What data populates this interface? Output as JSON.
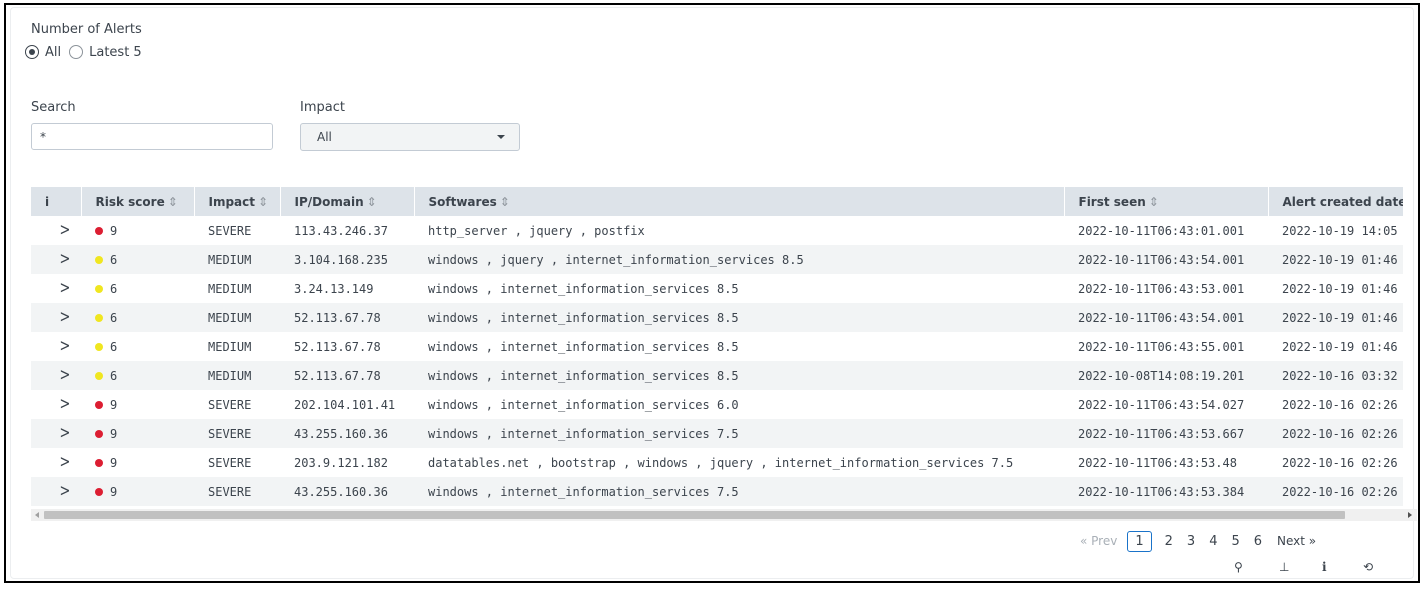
{
  "alerts_filter": {
    "label": "Number of Alerts",
    "options": [
      "All",
      "Latest 5"
    ],
    "selected": "All"
  },
  "search": {
    "label": "Search",
    "value": "*"
  },
  "impact_filter": {
    "label": "Impact",
    "selected": "All"
  },
  "table": {
    "columns": [
      "i",
      "Risk score",
      "Impact",
      "IP/Domain",
      "Softwares",
      "First seen",
      "Alert created date"
    ],
    "severity_colors": {
      "SEVERE": "#dc1e32",
      "MEDIUM": "#f0e620"
    },
    "rows": [
      {
        "risk": "9",
        "impact": "SEVERE",
        "ip": "113.43.246.37",
        "softwares": "http_server , jquery , postfix",
        "first_seen": "2022-10-11T06:43:01.001",
        "created": "2022-10-19 14:05"
      },
      {
        "risk": "6",
        "impact": "MEDIUM",
        "ip": "3.104.168.235",
        "softwares": "windows , jquery , internet_information_services 8.5",
        "first_seen": "2022-10-11T06:43:54.001",
        "created": "2022-10-19 01:46"
      },
      {
        "risk": "6",
        "impact": "MEDIUM",
        "ip": "3.24.13.149",
        "softwares": "windows , internet_information_services 8.5",
        "first_seen": "2022-10-11T06:43:53.001",
        "created": "2022-10-19 01:46"
      },
      {
        "risk": "6",
        "impact": "MEDIUM",
        "ip": "52.113.67.78",
        "softwares": "windows , internet_information_services 8.5",
        "first_seen": "2022-10-11T06:43:54.001",
        "created": "2022-10-19 01:46"
      },
      {
        "risk": "6",
        "impact": "MEDIUM",
        "ip": "52.113.67.78",
        "softwares": "windows , internet_information_services 8.5",
        "first_seen": "2022-10-11T06:43:55.001",
        "created": "2022-10-19 01:46"
      },
      {
        "risk": "6",
        "impact": "MEDIUM",
        "ip": "52.113.67.78",
        "softwares": "windows , internet_information_services 8.5",
        "first_seen": "2022-10-08T14:08:19.201",
        "created": "2022-10-16 03:32"
      },
      {
        "risk": "9",
        "impact": "SEVERE",
        "ip": "202.104.101.41",
        "softwares": "windows , internet_information_services 6.0",
        "first_seen": "2022-10-11T06:43:54.027",
        "created": "2022-10-16 02:26"
      },
      {
        "risk": "9",
        "impact": "SEVERE",
        "ip": "43.255.160.36",
        "softwares": "windows , internet_information_services 7.5",
        "first_seen": "2022-10-11T06:43:53.667",
        "created": "2022-10-16 02:26"
      },
      {
        "risk": "9",
        "impact": "SEVERE",
        "ip": "203.9.121.182",
        "softwares": "datatables.net , bootstrap , windows , jquery , internet_information_services 7.5",
        "first_seen": "2022-10-11T06:43:53.48",
        "created": "2022-10-16 02:26"
      },
      {
        "risk": "9",
        "impact": "SEVERE",
        "ip": "43.255.160.36",
        "softwares": "windows , internet_information_services 7.5",
        "first_seen": "2022-10-11T06:43:53.384",
        "created": "2022-10-16 02:26"
      }
    ]
  },
  "pagination": {
    "prev": "« Prev",
    "pages": [
      "1",
      "2",
      "3",
      "4",
      "5",
      "6"
    ],
    "current": "1",
    "next": "Next »"
  },
  "toolbar": {
    "icons": [
      "search-icon",
      "export-icon",
      "info-icon",
      "refresh-icon"
    ],
    "glyphs": [
      "⚲",
      "⊥",
      "i",
      "⟲"
    ]
  }
}
